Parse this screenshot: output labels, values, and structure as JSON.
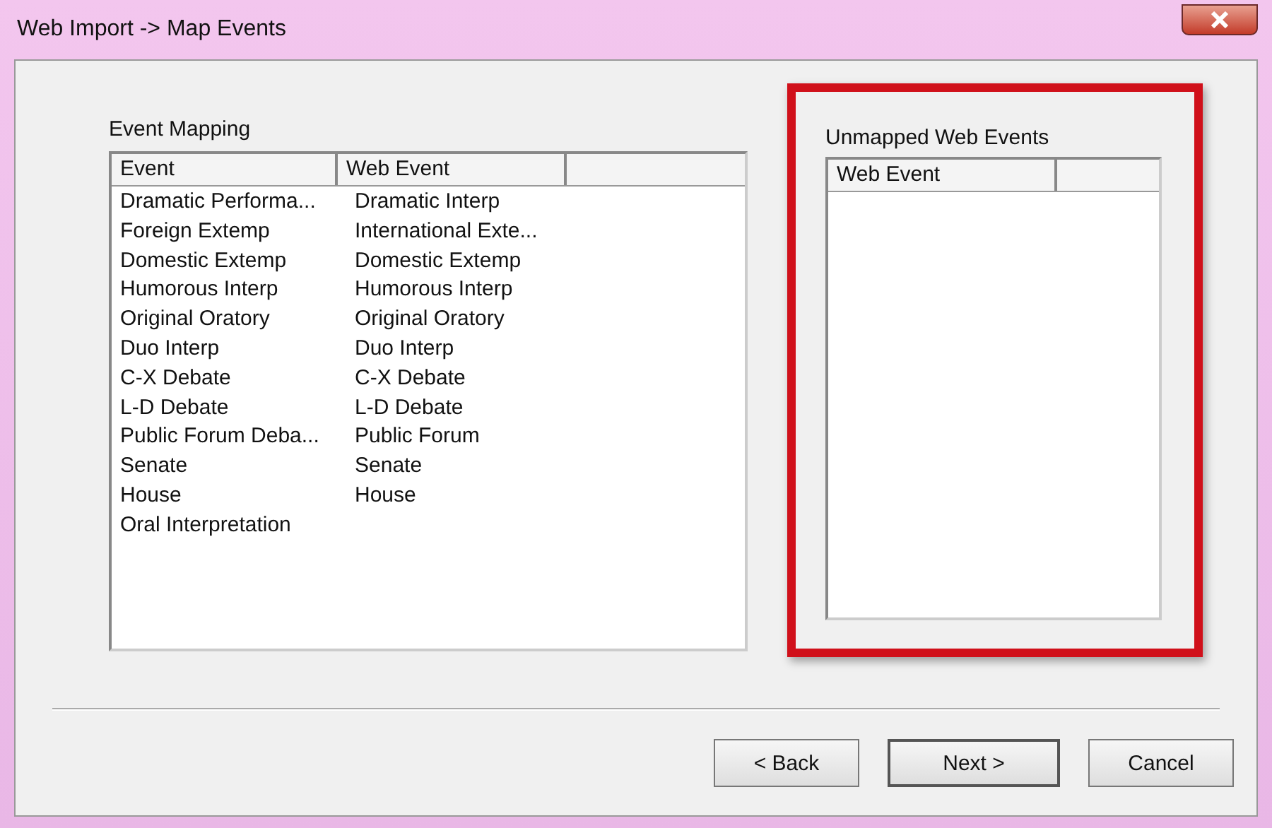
{
  "window": {
    "title": "Web Import -> Map Events"
  },
  "event_mapping": {
    "label": "Event Mapping",
    "columns": [
      "Event",
      "Web Event"
    ],
    "rows": [
      {
        "event": "Dramatic Performa...",
        "web_event": "Dramatic Interp"
      },
      {
        "event": "Foreign Extemp",
        "web_event": "International Exte..."
      },
      {
        "event": "Domestic Extemp",
        "web_event": "Domestic Extemp"
      },
      {
        "event": "Humorous Interp",
        "web_event": "Humorous Interp"
      },
      {
        "event": "Original Oratory",
        "web_event": "Original Oratory"
      },
      {
        "event": "Duo Interp",
        "web_event": "Duo Interp"
      },
      {
        "event": "C-X Debate",
        "web_event": "C-X Debate"
      },
      {
        "event": "L-D Debate",
        "web_event": "L-D Debate"
      },
      {
        "event": "Public Forum Deba...",
        "web_event": "Public Forum"
      },
      {
        "event": "Senate",
        "web_event": "Senate"
      },
      {
        "event": "House",
        "web_event": "House"
      },
      {
        "event": "Oral Interpretation"
      }
    ]
  },
  "unmapped": {
    "label": "Unmapped Web Events",
    "columns": [
      "Web Event"
    ],
    "highlighted": true
  },
  "buttons": [
    {
      "label": "< Back",
      "default": false
    },
    {
      "label": "Next >",
      "default": true
    },
    {
      "label": "Cancel",
      "default": false
    }
  ]
}
